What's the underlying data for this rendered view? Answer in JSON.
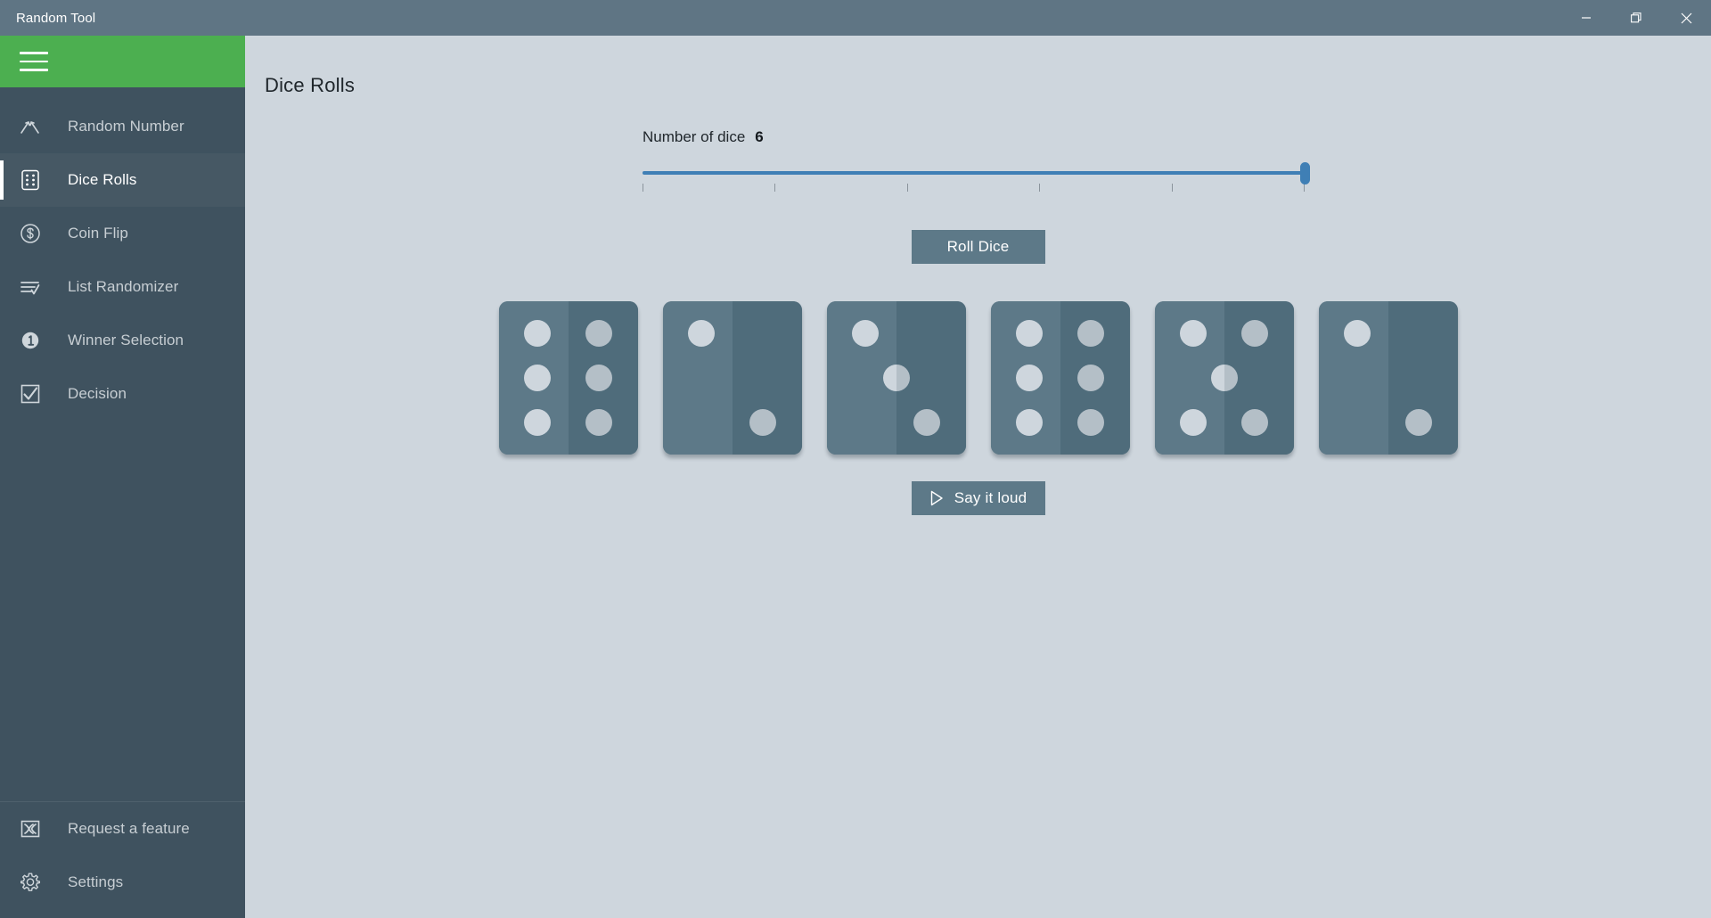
{
  "window": {
    "title": "Random Tool",
    "controls": [
      {
        "name": "minimize",
        "glyph": "minimize-icon"
      },
      {
        "name": "maximize",
        "glyph": "restore-icon"
      },
      {
        "name": "close",
        "glyph": "close-icon"
      }
    ]
  },
  "sidebar": {
    "menu_icon": "hamburger-icon",
    "accent_color": "#4caf50",
    "background_color": "#3f525f",
    "items": [
      {
        "label": "Random Number",
        "icon": "random-number-icon",
        "selected": false
      },
      {
        "label": "Dice Rolls",
        "icon": "dice-icon",
        "selected": true
      },
      {
        "label": "Coin Flip",
        "icon": "coin-icon",
        "selected": false
      },
      {
        "label": "List Randomizer",
        "icon": "list-check-icon",
        "selected": false
      },
      {
        "label": "Winner Selection",
        "icon": "number-one-circle-icon",
        "selected": false
      },
      {
        "label": "Decision",
        "icon": "checkbox-checked-icon",
        "selected": false
      }
    ],
    "bottom_items": [
      {
        "label": "Request a feature",
        "icon": "feedback-icon"
      },
      {
        "label": "Settings",
        "icon": "gear-icon"
      }
    ]
  },
  "main": {
    "page_title": "Dice Rolls",
    "slider": {
      "label": "Number of dice",
      "value": "6",
      "min": 1,
      "max": 6,
      "tick_count": 6,
      "fill_color": "#3f7fb5"
    },
    "roll_button": {
      "label": "Roll Dice"
    },
    "say_button": {
      "label": "Say it loud",
      "icon": "play-icon"
    },
    "dice": [
      {
        "value": 6
      },
      {
        "value": 2
      },
      {
        "value": 3
      },
      {
        "value": 6
      },
      {
        "value": 5
      },
      {
        "value": 2
      }
    ],
    "colors": {
      "background": "#ced6dd",
      "die_face": "#5d7988",
      "die_shadow_face": "#4f6c7b",
      "button": "#5d7988"
    }
  }
}
